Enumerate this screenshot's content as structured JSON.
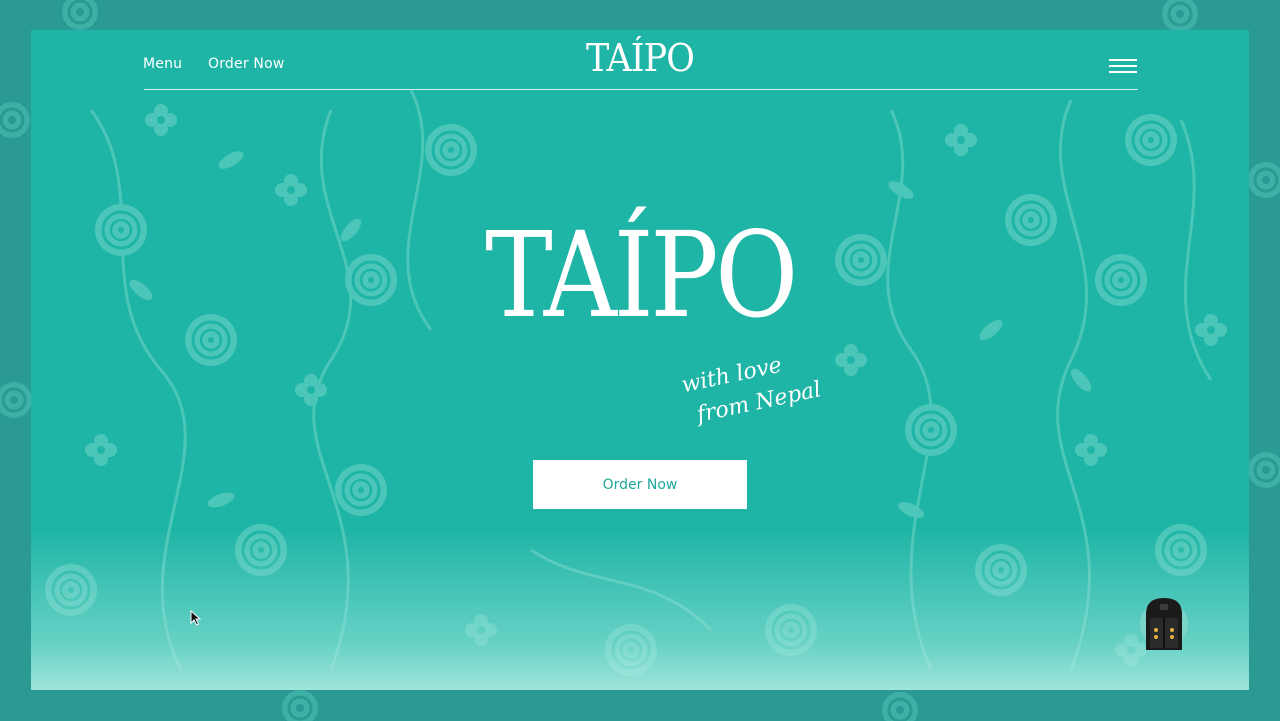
{
  "header": {
    "nav_menu": "Menu",
    "nav_order": "Order Now",
    "logo": "TAÍPO"
  },
  "hero": {
    "title": "TAÍPO",
    "tagline_line1": "with love",
    "tagline_line2": "from Nepal",
    "cta_label": "Order Now"
  },
  "icons": {
    "menu": "hamburger-icon",
    "widget": "door-icon",
    "cursor": "mouse-pointer-icon"
  },
  "colors": {
    "page_bg": "#1fb5a6",
    "frame_bg": "#2a9a92",
    "pattern": "#5ccdc0",
    "text": "#ffffff",
    "cta_text": "#1fa89b"
  }
}
